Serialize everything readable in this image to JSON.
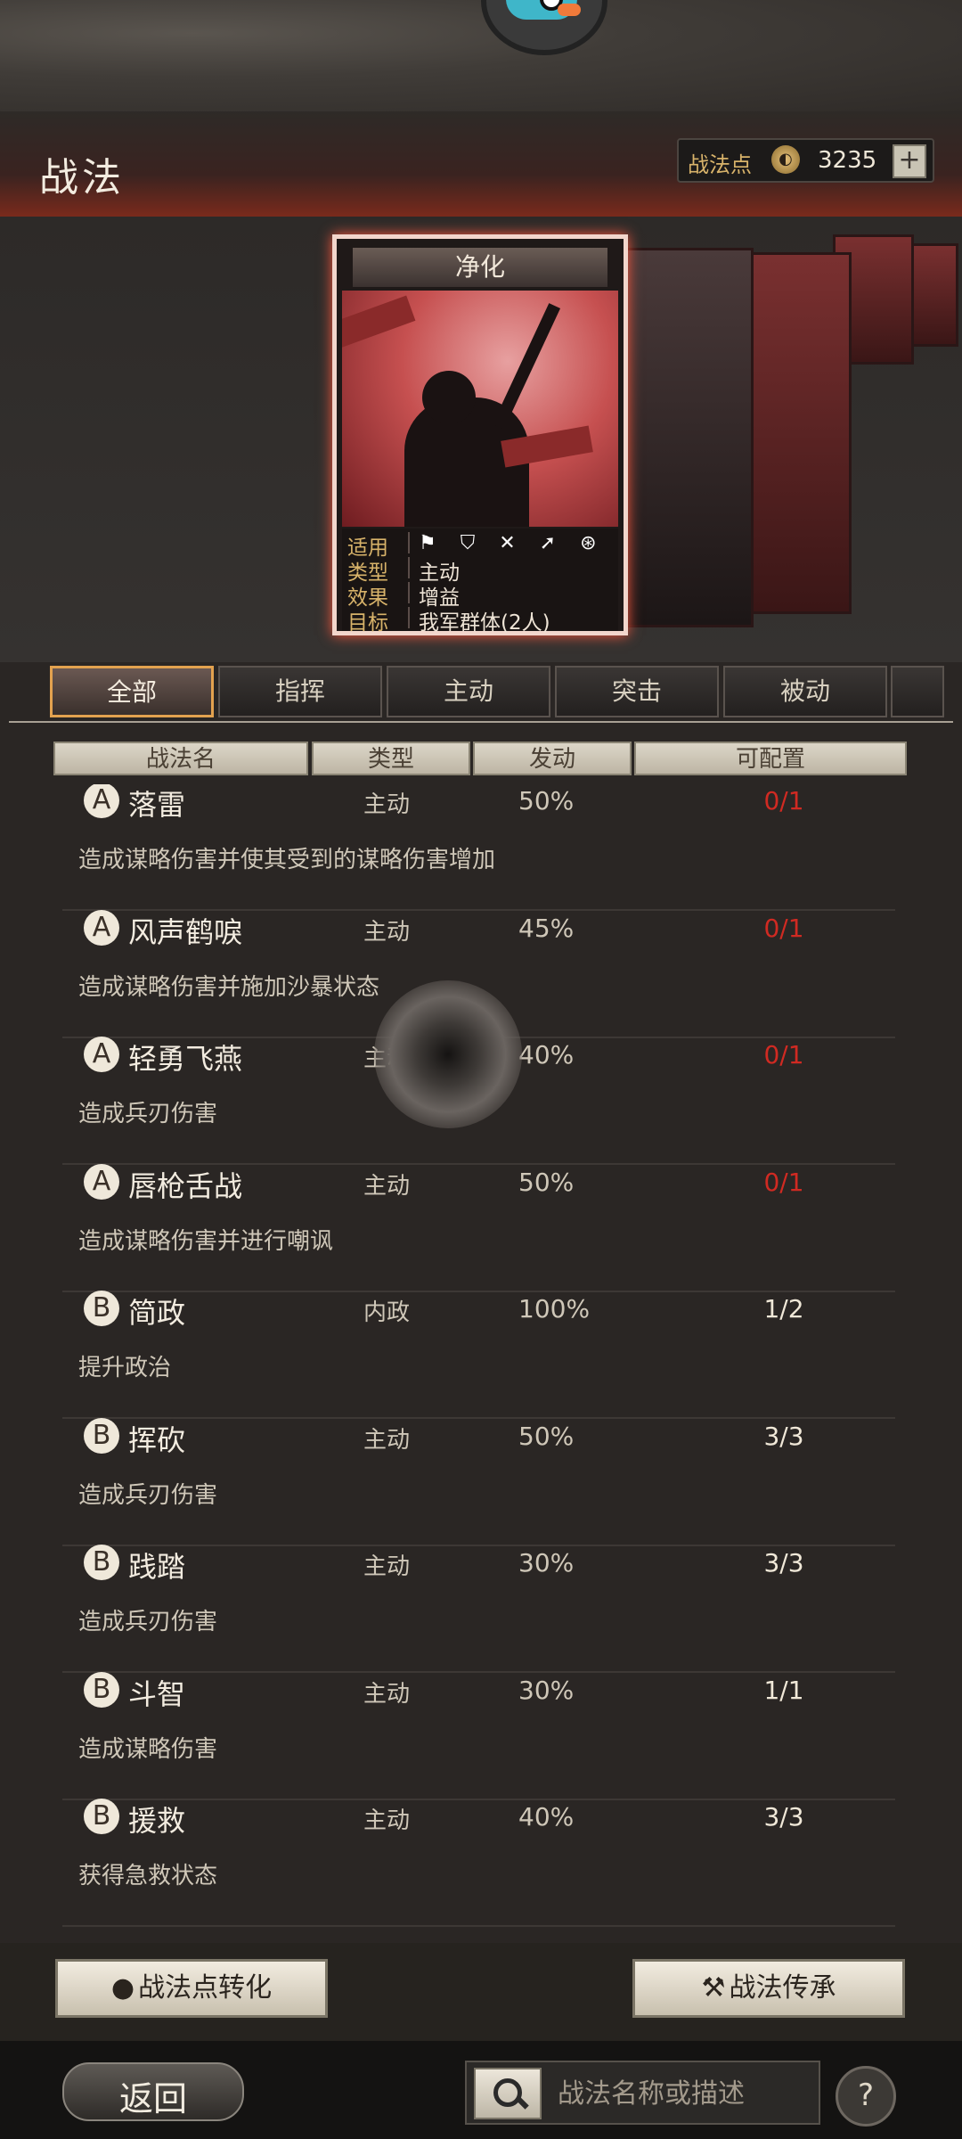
{
  "header": {
    "title": "战法",
    "points_label": "战法点",
    "points_value": "3235",
    "add_label": "+"
  },
  "featured_card": {
    "name": "净化",
    "rows": [
      {
        "key": "适用",
        "value": ""
      },
      {
        "key": "类型",
        "value": "主动"
      },
      {
        "key": "效果",
        "value": "增益"
      },
      {
        "key": "目标",
        "value": "我军群体(2人)"
      }
    ],
    "usage_icons": "⚑ ⛉ ✕ ➚ ⊛"
  },
  "tabs": [
    "全部",
    "指挥",
    "主动",
    "突击",
    "被动"
  ],
  "active_tab": "全部",
  "columns": [
    "战法名",
    "类型",
    "发动",
    "可配置"
  ],
  "skills": [
    {
      "grade": "A",
      "name": "落雷",
      "type": "主动",
      "rate": "50%",
      "available": "0/1",
      "desc": "造成谋略伤害并使其受到的谋略伤害增加",
      "full": true
    },
    {
      "grade": "A",
      "name": "风声鹤唳",
      "type": "主动",
      "rate": "45%",
      "available": "0/1",
      "desc": "造成谋略伤害并施加沙暴状态",
      "full": true
    },
    {
      "grade": "A",
      "name": "轻勇飞燕",
      "type": "主动",
      "rate": "40%",
      "available": "0/1",
      "desc": "造成兵刃伤害",
      "full": true
    },
    {
      "grade": "A",
      "name": "唇枪舌战",
      "type": "主动",
      "rate": "50%",
      "available": "0/1",
      "desc": "造成谋略伤害并进行嘲讽",
      "full": true
    },
    {
      "grade": "B",
      "name": "简政",
      "type": "内政",
      "rate": "100%",
      "available": "1/2",
      "desc": "提升政治",
      "full": false
    },
    {
      "grade": "B",
      "name": "挥砍",
      "type": "主动",
      "rate": "50%",
      "available": "3/3",
      "desc": "造成兵刃伤害",
      "full": false
    },
    {
      "grade": "B",
      "name": "践踏",
      "type": "主动",
      "rate": "30%",
      "available": "3/3",
      "desc": "造成兵刃伤害",
      "full": false
    },
    {
      "grade": "B",
      "name": "斗智",
      "type": "主动",
      "rate": "30%",
      "available": "1/1",
      "desc": "造成谋略伤害",
      "full": false
    },
    {
      "grade": "B",
      "name": "援救",
      "type": "主动",
      "rate": "40%",
      "available": "3/3",
      "desc": "获得急救状态",
      "full": false
    }
  ],
  "actions": {
    "convert_label": "战法点转化",
    "inherit_label": "战法传承"
  },
  "footer": {
    "back_label": "返回",
    "search_placeholder": "战法名称或描述",
    "help_label": "?"
  },
  "colors": {
    "accent_red": "#d02a22",
    "tab_active_border": "#e3a24f",
    "header_red": "#7a2a1c"
  }
}
